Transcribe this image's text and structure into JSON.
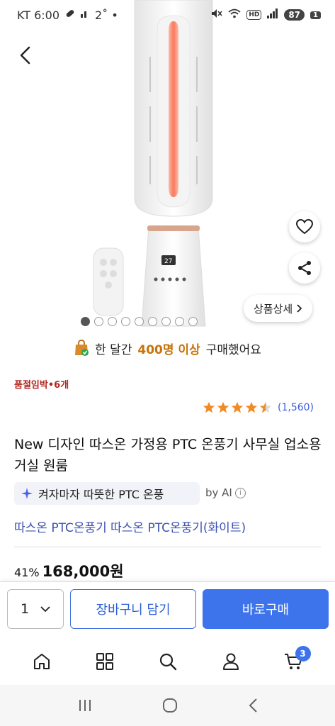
{
  "status_bar": {
    "carrier_time": "KT 6:00",
    "extra": "2˚ •",
    "hd": "HD",
    "battery": "87",
    "sim": "1"
  },
  "hero": {
    "detail_label": "상품상세",
    "slide_count": 9,
    "active_slide": 1
  },
  "banner": {
    "prefix": "한 달간",
    "highlight": "400명 이상",
    "suffix": "구매했어요"
  },
  "stock_label": "품절임박•6개",
  "rating": {
    "stars": 4.5,
    "review_count": "(1,560)"
  },
  "product": {
    "title": "New 디자인 따스온 가정용 PTC 온풍기 사무실 업소용 거실 원룸",
    "ai_summary": "켜자마자 따뜻한 PTC 온풍",
    "ai_by": "by AI",
    "options": "따스온 PTC온풍기 따스온 PTC온풍기(화이트)",
    "discount": "41%",
    "price": "168,000원"
  },
  "buy_bar": {
    "quantity": "1",
    "cart_label": "장바구니 담기",
    "buy_label": "바로구매"
  },
  "app_nav": {
    "cart_count": "3"
  },
  "colors": {
    "accent": "#3d73eb",
    "highlight": "#c8720a",
    "stock": "#b3261e",
    "star": "#f08a24"
  }
}
